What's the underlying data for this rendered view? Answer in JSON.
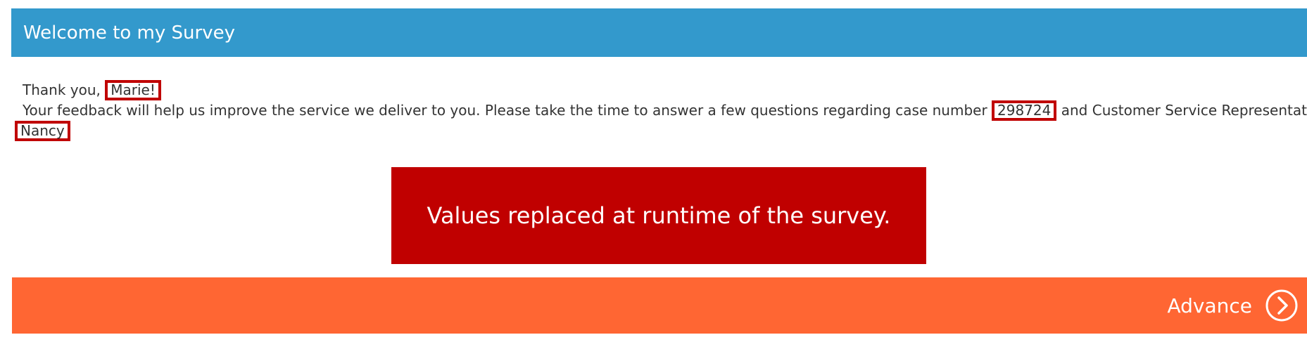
{
  "header": {
    "title": "Welcome to my Survey"
  },
  "body": {
    "greeting_prefix": "Thank you, ",
    "respondent_name": "Marie!",
    "intro": "Your feedback will help us improve the service we deliver to you.  Please take the time to answer a few questions regarding case number ",
    "case_number": "298724",
    "rep_text": "and Customer Service Representative",
    "rep_name": "Nancy"
  },
  "callout": {
    "text": "Values replaced at runtime of the survey."
  },
  "footer": {
    "advance_label": "Advance",
    "advance_icon": "chevron-right-circle-icon"
  },
  "colors": {
    "header_bg": "#3399cc",
    "footer_bg": "#ff6633",
    "highlight": "#c00000",
    "callout_bg": "#c00000"
  }
}
